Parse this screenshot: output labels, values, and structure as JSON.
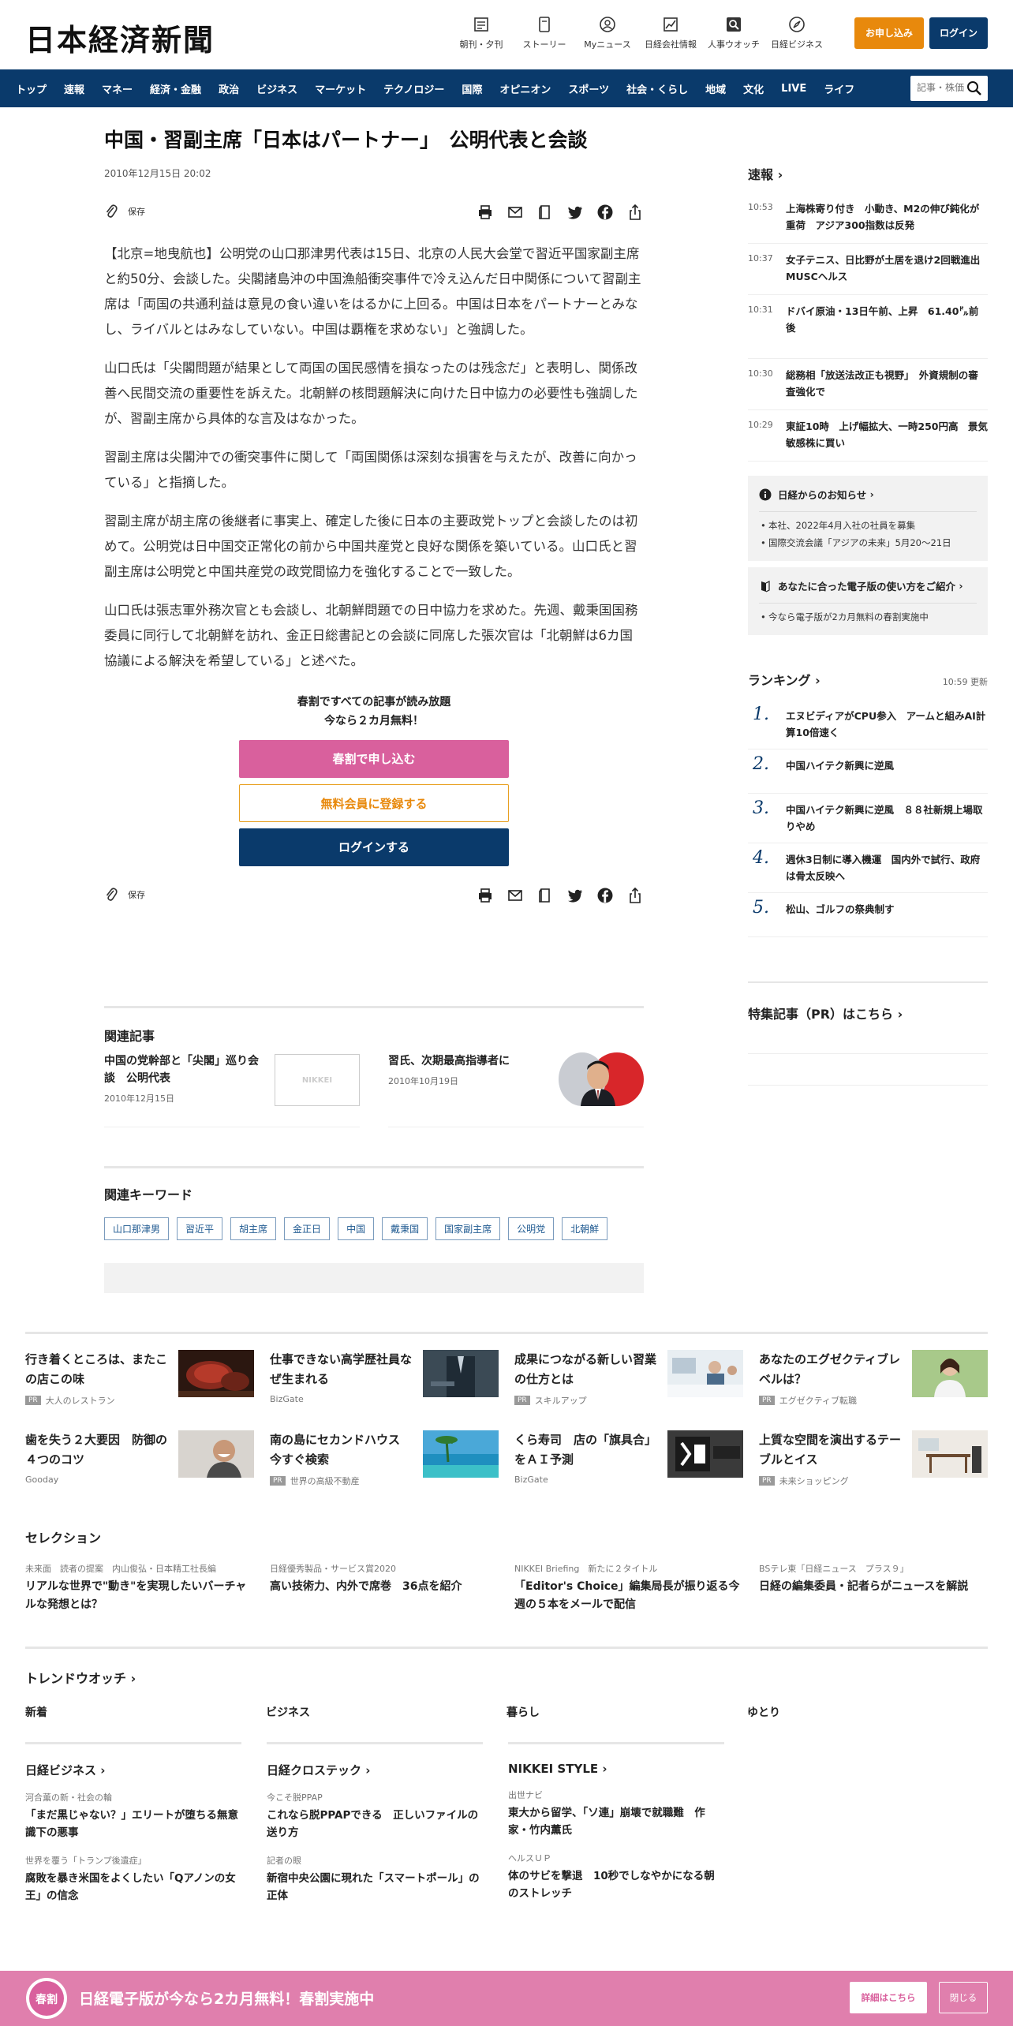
{
  "header": {
    "logo": "日本経済新聞",
    "nav": [
      {
        "label": "朝刊・夕刊",
        "icon": "newspaper-icon"
      },
      {
        "label": "ストーリー",
        "icon": "story-icon"
      },
      {
        "label": "Myニュース",
        "icon": "user-icon"
      },
      {
        "label": "日経会社情報",
        "icon": "chart-icon"
      },
      {
        "label": "人事ウオッチ",
        "icon": "search-icon"
      },
      {
        "label": "日経ビジネス",
        "icon": "compass-icon"
      }
    ],
    "subscribe": "お申し込み",
    "login": "ログイン"
  },
  "navbar": {
    "items": [
      "トップ",
      "速報",
      "マネー",
      "経済・金融",
      "政治",
      "ビジネス",
      "マーケット",
      "テクノロジー",
      "国際",
      "オピニオン",
      "スポーツ",
      "社会・くらし",
      "地域",
      "文化",
      "LIVE",
      "ライフ"
    ],
    "search_placeholder": "記事・株価"
  },
  "article": {
    "headline": "中国・習副主席「日本はパートナー」　公明代表と会談",
    "date": "2010年12月15日 20:02",
    "save": "保存",
    "paragraphs": [
      "【北京=地曳航也】公明党の山口那津男代表は15日、北京の人民大会堂で習近平国家副主席と約50分、会談した。尖閣諸島沖の中国漁船衝突事件で冷え込んだ日中関係について習副主席は「両国の共通利益は意見の食い違いをはるかに上回る。中国は日本をパートナーとみなし、ライバルとはみなしていない。中国は覇権を求めない」と強調した。",
      "山口氏は「尖閣問題が結果として両国の国民感情を損なったのは残念だ」と表明し、関係改善へ民間交流の重要性を訴えた。北朝鮮の核問題解決に向けた日中協力の必要性も強調したが、習副主席から具体的な言及はなかった。",
      "習副主席は尖閣沖での衝突事件に関して「両国関係は深刻な損害を与えたが、改善に向かっている」と指摘した。",
      "習副主席が胡主席の後継者に事実上、確定した後に日本の主要政党トップと会談したのは初めて。公明党は日中国交正常化の前から中国共産党と良好な関係を築いている。山口氏と習副主席は公明党と中国共産党の政党間協力を強化することで一致した。",
      "山口氏は張志軍外務次官とも会談し、北朝鮮問題での日中協力を求めた。先週、戴秉国国務委員に同行して北朝鮮を訪れ、金正日総書記との会談に同席した張次官は「北朝鮮は6カ国協議による解決を希望している」と述べた。"
    ]
  },
  "paywall": {
    "line1": "春割ですべての記事が読み放題",
    "line2": "今なら２カ月無料！",
    "subscribe": "春割で申し込む",
    "register": "無料会員に登録する",
    "login": "ログインする"
  },
  "related": {
    "title": "関連記事",
    "items": [
      {
        "title": "中国の党幹部と「尖閣」巡り会談　公明代表",
        "date": "2010年12月15日",
        "thumb": "NIKKEI"
      },
      {
        "title": "習氏、次期最高指導者に",
        "date": "2010年10月19日"
      }
    ]
  },
  "keywords": {
    "title": "関連キーワード",
    "items": [
      "山口那津男",
      "習近平",
      "胡主席",
      "金正日",
      "中国",
      "戴秉国",
      "国家副主席",
      "公明党",
      "北朝鮮"
    ]
  },
  "sidebar": {
    "breaking_title": "速報",
    "breaking": [
      {
        "time": "10:53",
        "text": "上海株寄り付き　小動き、M2の伸び鈍化が重荷　アジア300指数は反発"
      },
      {
        "time": "10:37",
        "text": "女子テニス、日比野が土居を退け2回戦進出　MUSCヘルス"
      },
      {
        "time": "10:31",
        "text": "ドバイ原油・13日午前、上昇　61.40㌦前後"
      },
      {
        "time": "10:30",
        "text": "総務相「放送法改正も視野」　外資規制の審査強化で"
      },
      {
        "time": "10:29",
        "text": "東証10時　上げ幅拡大、一時250円高　景気敏感株に買い"
      }
    ],
    "notice_title": "日経からのお知らせ",
    "notice_items": [
      "本社、2022年4月入社の社員を募集",
      "国際交流会議「アジアの未来」5月20～21日"
    ],
    "guide_title": "あなたに合った電子版の使い方をご紹介",
    "guide_items": [
      "今なら電子版が2カ月無料の春割実施中"
    ],
    "ranking_title": "ランキング",
    "ranking_time": "10:59  更新",
    "ranking": [
      {
        "num": "1.",
        "text": "エヌビディアがCPU参入　アームと組みAI計算10倍速く"
      },
      {
        "num": "2.",
        "text": "中国ハイテク新興に逆風"
      },
      {
        "num": "3.",
        "text": "中国ハイテク新興に逆風　８８社新規上場取りやめ"
      },
      {
        "num": "4.",
        "text": "週休3日制に導入機運　国内外で試行、政府は骨太反映へ"
      },
      {
        "num": "5.",
        "text": "松山、ゴルフの祭典制す"
      }
    ],
    "pr_title": "特集記事（PR）はこちら"
  },
  "pr_cards": [
    {
      "title": "行き着くところは、またこの店この味",
      "source": "大人のレストラン",
      "pr": "PR"
    },
    {
      "title": "仕事できない高学歴社員なぜ生まれる",
      "source": "BizGate",
      "pr": ""
    },
    {
      "title": "成果につながる新しい習業の仕方とは",
      "source": "スキルアップ",
      "pr": "PR"
    },
    {
      "title": "あなたのエグゼクティブレベルは？",
      "source": "エグゼクティブ転職",
      "pr": "PR"
    },
    {
      "title": "歯を失う２大要因　防御の４つのコツ",
      "source": "Gooday",
      "pr": ""
    },
    {
      "title": "南の島にセカンドハウス　今すぐ検索",
      "source": "世界の高級不動産",
      "pr": "PR"
    },
    {
      "title": "くら寿司　店の「旗具合」をＡＩ予測",
      "source": "BizGate",
      "pr": ""
    },
    {
      "title": "上質な空間を演出するテーブルとイス",
      "source": "未来ショッピング",
      "pr": "PR"
    }
  ],
  "selection": {
    "title": "セレクション",
    "items": [
      {
        "kicker": "未来面　読者の提案　内山俊弘・日本精工社長編",
        "title": "リアルな世界で\"動き\"を実現したいバーチャルな発想とは？"
      },
      {
        "kicker": "日経優秀製品・サービス賞2020",
        "title": "高い技術力、内外で席巻　36点を紹介"
      },
      {
        "kicker": "NIKKEI Briefing　新たに２タイトル",
        "title": "「Editor's Choice」編集局長が振り返る今週の５本をメールで配信"
      },
      {
        "kicker": "BSテレ東「日経ニュース　プラス９」",
        "title": "日経の編集委員・記者らがニュースを解説"
      }
    ]
  },
  "trend": {
    "title": "トレンドウオッチ",
    "tabs": [
      "新着",
      "ビジネス",
      "暮らし",
      "ゆとり"
    ]
  },
  "media": [
    {
      "title": "日経ビジネス",
      "items": [
        {
          "kicker": "河合薫の新・社会の輪",
          "title": "「まだ黒じゃない？」エリートが堕ちる無意識下の悪事"
        },
        {
          "kicker": "世界を覆う「トランプ後遺症」",
          "title": "腐敗を暴き米国をよくしたい「Qアノンの女王」の信念"
        }
      ]
    },
    {
      "title": "日経クロステック",
      "items": [
        {
          "kicker": "今こそ脱PPAP",
          "title": "これなら脱PPAPできる　正しいファイルの送り方"
        },
        {
          "kicker": "記者の眼",
          "title": "新宿中央公園に現れた「スマートポール」の正体"
        }
      ]
    },
    {
      "title": "NIKKEI STYLE",
      "items": [
        {
          "kicker": "出世ナビ",
          "title": "東大から留学、「ソ連」崩壊で就職難　作家・竹内薫氏"
        },
        {
          "kicker": "ヘルスＵＰ",
          "title": "体のサビを撃退　10秒でしなやかになる朝のストレッチ"
        }
      ]
    }
  ],
  "banner": {
    "badge": "春割",
    "message": "日経電子版が今なら2カ月無料！春割実施中",
    "detail": "詳細はこちら",
    "close": "閉じる"
  }
}
